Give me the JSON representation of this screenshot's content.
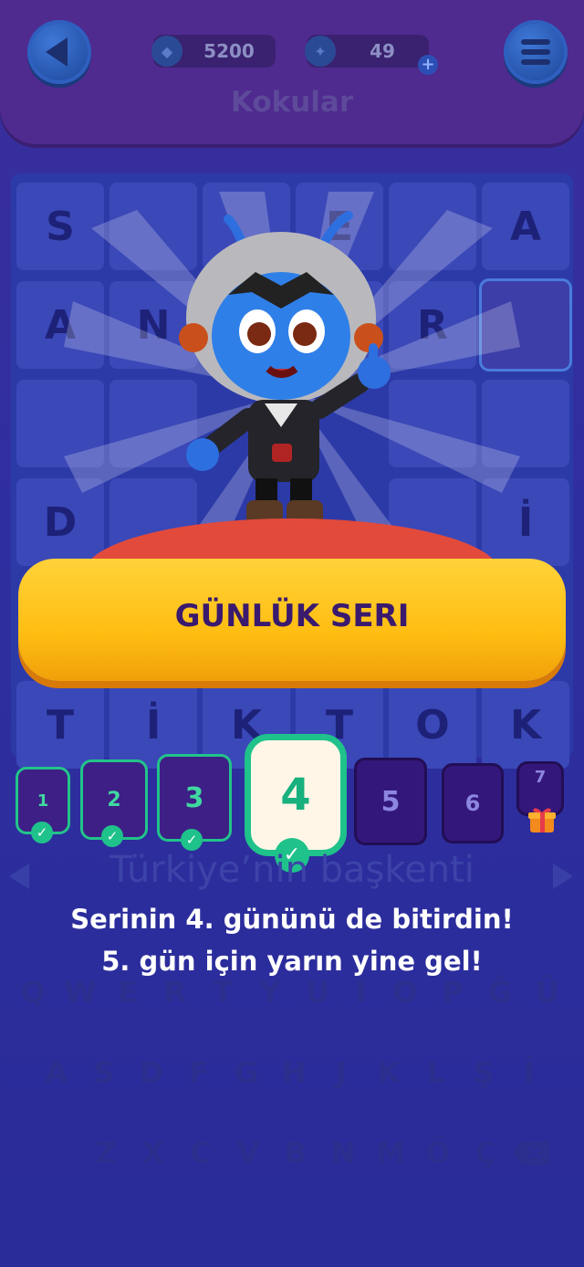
{
  "header": {
    "gems": "5200",
    "coins": "49",
    "plus": "+",
    "title": "Kokular"
  },
  "board": {
    "row1": [
      "S",
      "",
      "",
      "E",
      "",
      "A"
    ],
    "row2": [
      "A",
      "N",
      "",
      "",
      "R",
      ""
    ],
    "row4": [
      "D",
      "",
      "",
      "",
      "",
      "İ"
    ],
    "row6": [
      "T",
      "İ",
      "K",
      "T",
      "O",
      "K"
    ]
  },
  "banner": {
    "title": "GÜNLÜK SERI"
  },
  "streak": {
    "days": [
      "1",
      "2",
      "3",
      "4",
      "5",
      "6",
      "7"
    ],
    "completed": 4
  },
  "clue": "Türkiye’nin başkenti",
  "message": {
    "line1": "Serinin 4. gününü de bitirdin!",
    "line2": "5. gün için yarın yine gel!"
  },
  "keyboard": {
    "row1": [
      "Q",
      "W",
      "E",
      "R",
      "T",
      "Y",
      "U",
      "I",
      "O",
      "P",
      "Ğ",
      "Ü"
    ],
    "row2": [
      "A",
      "S",
      "D",
      "F",
      "G",
      "H",
      "J",
      "K",
      "L",
      "Ş",
      "İ"
    ],
    "row3": [
      "Z",
      "X",
      "C",
      "V",
      "B",
      "N",
      "M",
      "Ö",
      "Ç"
    ]
  },
  "colors": {
    "accent": "#1fc28a",
    "banner": "#ffc81e",
    "header": "#4f2a8f"
  },
  "icons": [
    "back-arrow-icon",
    "menu-icon",
    "gem-icon",
    "coin-icon",
    "checkmark-icon",
    "gift-icon",
    "backspace-icon"
  ]
}
